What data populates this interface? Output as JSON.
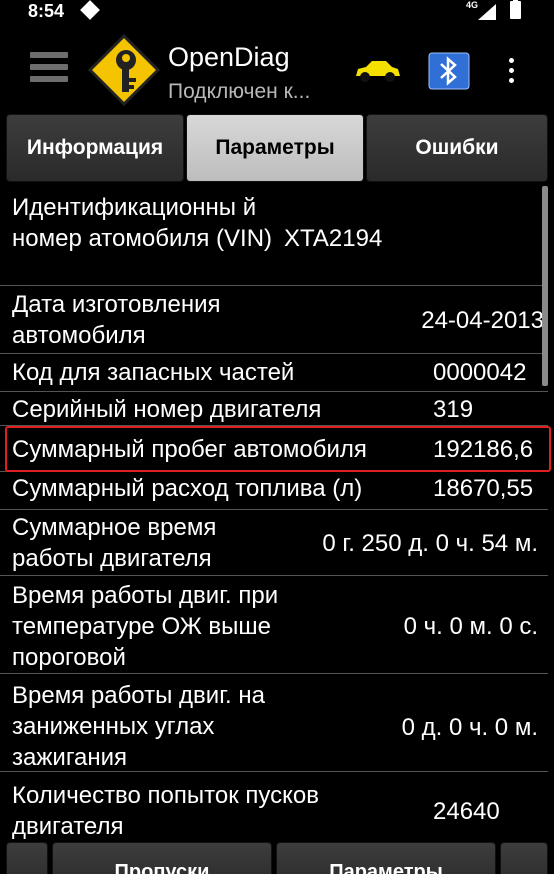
{
  "status_bar": {
    "time": "8:54",
    "network": "4G"
  },
  "app_bar": {
    "title": "OpenDiag",
    "subtitle": "Подключен к...",
    "icons": [
      "menu-icon",
      "app-logo-key-icon",
      "car-icon",
      "bluetooth-icon",
      "overflow-menu-icon"
    ]
  },
  "tabs": [
    {
      "label": "Информация",
      "active": false
    },
    {
      "label": "Параметры",
      "active": true
    },
    {
      "label": "Ошибки",
      "active": false
    }
  ],
  "parameters": [
    {
      "name": "Идентификационны й номер атомобиля (VIN)",
      "value": "XTA2194"
    },
    {
      "name": "Дата изготовления автомобиля",
      "value": "24-04-2013"
    },
    {
      "name": "Код для запасных частей",
      "value": "0000042"
    },
    {
      "name": "Серийный номер двигателя",
      "value": "319"
    },
    {
      "name": "Суммарный пробег автомобиля",
      "value": "192186,6"
    },
    {
      "name": "Суммарный расход топлива (л)",
      "value": "18670,55"
    },
    {
      "name": "Суммарное время работы двигателя",
      "value": "0 г. 250 д. 0 ч. 54 м."
    },
    {
      "name": "Время работы двиг. при температуре ОЖ выше пороговой",
      "value": "0 ч. 0 м. 0 с."
    },
    {
      "name": "Время работы двиг. на заниженных углах зажигания",
      "value": "0 д. 0 ч. 0 м."
    },
    {
      "name": "Количество попыток пусков двигателя",
      "value": "24640"
    }
  ],
  "bottom_buttons": [
    {
      "label": "Пропуски"
    },
    {
      "label": "Параметры"
    }
  ],
  "colors": {
    "background": "#000000",
    "tab_active": "#cfcfcf",
    "tab_inactive": "#333333",
    "highlight_border": "#e02020",
    "divider": "#555555"
  }
}
